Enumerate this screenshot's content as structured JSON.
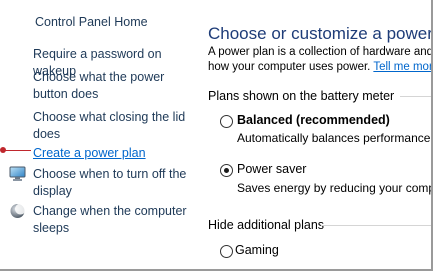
{
  "sidebar": {
    "home": "Control Panel Home",
    "links": [
      {
        "label": "Require a password on wakeup"
      },
      {
        "label": "Choose what the power button does"
      },
      {
        "label": "Choose what closing the lid does"
      },
      {
        "label": "Create a power plan"
      },
      {
        "label": "Choose when to turn off the display",
        "icon": "display-icon"
      },
      {
        "label": "Change when the computer sleeps",
        "icon": "moon-icon"
      }
    ]
  },
  "main": {
    "title": "Choose or customize a power plan",
    "description_line1": "A power plan is a collection of hardware and sy",
    "description_line2": "how your computer uses power.",
    "learn_more": "Tell me more a",
    "battery_group": "Plans shown on the battery meter",
    "plans": [
      {
        "name": "Balanced (recommended)",
        "desc": "Automatically balances performance with",
        "selected": false
      },
      {
        "name": "Power saver",
        "desc": "Saves energy by reducing your computer",
        "selected": true
      }
    ],
    "hidden_group": "Hide additional plans",
    "hidden_plans": [
      {
        "name": "Gaming",
        "selected": false
      }
    ]
  },
  "colors": {
    "link": "#1e3957",
    "active_link": "#0066cc",
    "title": "#1e3c78",
    "pointer": "#c0272d"
  }
}
